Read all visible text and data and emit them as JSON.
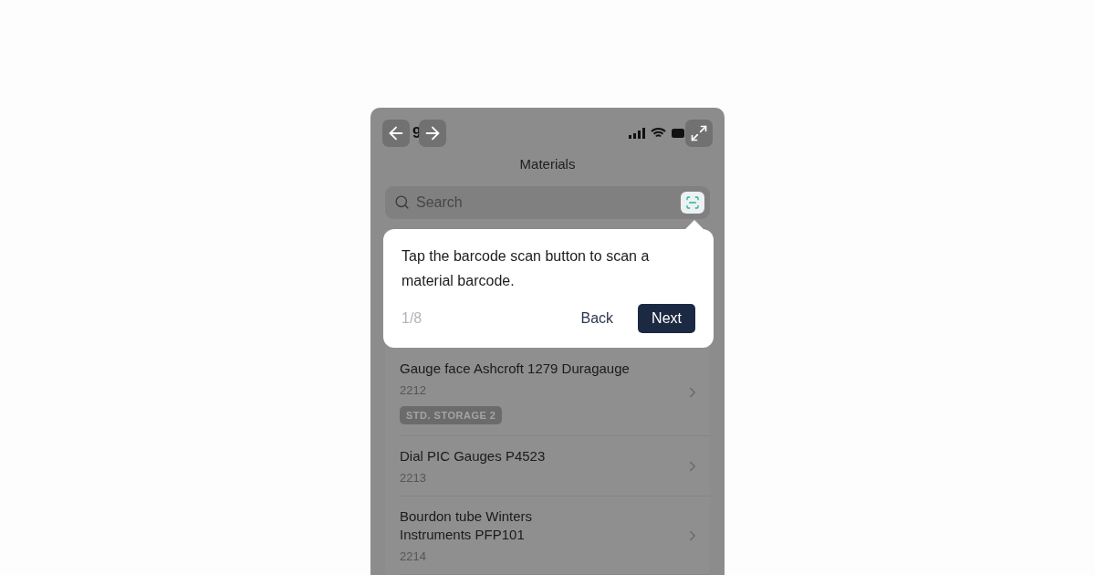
{
  "status_bar": {
    "time": "9"
  },
  "overlay_buttons": [
    {
      "kind": "back"
    },
    {
      "kind": "forward"
    },
    {
      "kind": "expand"
    }
  ],
  "header": {
    "title": "Materials"
  },
  "search": {
    "placeholder": "Search"
  },
  "tooltip": {
    "text": "Tap the barcode scan button to scan a material barcode.",
    "step": "1/8",
    "buttons": [
      {
        "label": "Back",
        "kind": "secondary"
      },
      {
        "label": "Next",
        "kind": "primary"
      }
    ]
  },
  "materials": [
    {
      "name": "Gauge face Ashcroft 1279 Duragauge",
      "code": "2212",
      "tag": "STD. STORAGE 2"
    },
    {
      "name": "Dial PIC Gauges P4523",
      "code": "2213"
    },
    {
      "name": "Bourdon tube Winters Instruments PFP101",
      "code": "2214"
    }
  ]
}
